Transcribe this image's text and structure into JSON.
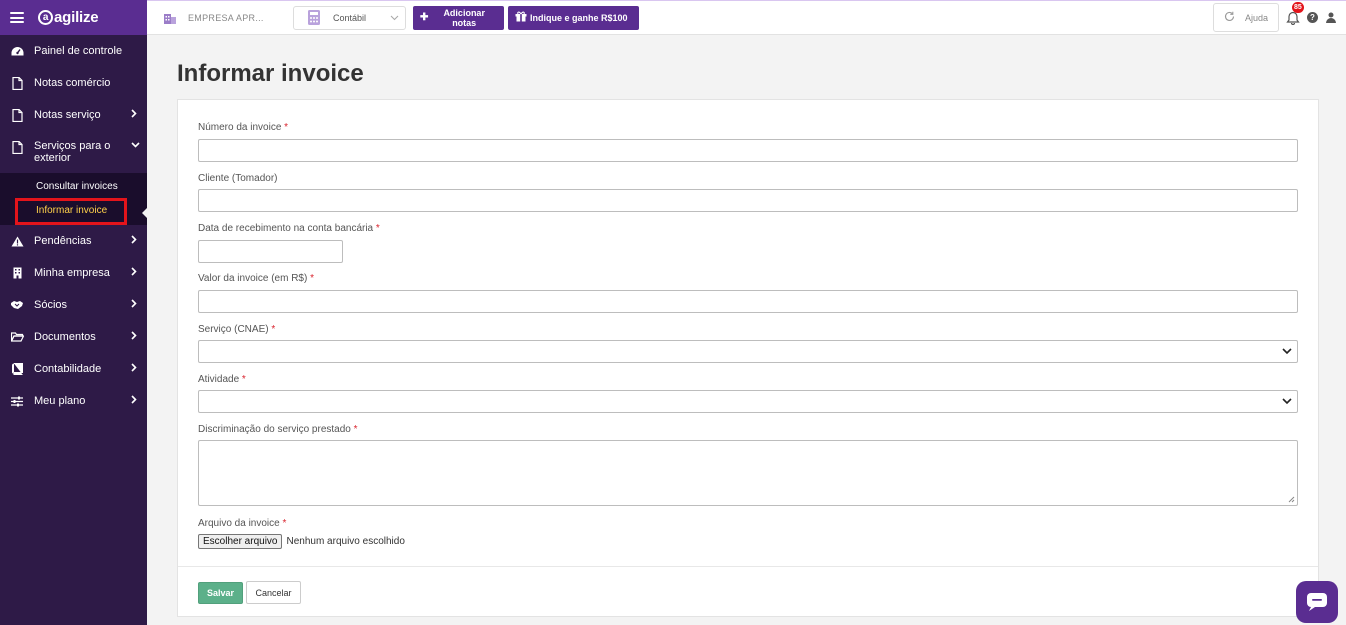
{
  "sidebar": {
    "brand": "agilize",
    "brand_mark": "a",
    "items": [
      {
        "label": "Painel de controle",
        "icon": "dashboard-icon",
        "chevron": false
      },
      {
        "label": "Notas comércio",
        "icon": "document-icon",
        "chevron": false
      },
      {
        "label": "Notas serviço",
        "icon": "document-icon",
        "chevron": true
      },
      {
        "label": "Serviços para o exterior",
        "icon": "document-icon",
        "chevron": "down"
      },
      {
        "label": "Pendências",
        "icon": "warning-icon",
        "chevron": true
      },
      {
        "label": "Minha empresa",
        "icon": "building-icon",
        "chevron": true
      },
      {
        "label": "Sócios",
        "icon": "handshake-icon",
        "chevron": true
      },
      {
        "label": "Documentos",
        "icon": "folder-icon",
        "chevron": true
      },
      {
        "label": "Contabilidade",
        "icon": "book-icon",
        "chevron": true
      },
      {
        "label": "Meu plano",
        "icon": "sliders-icon",
        "chevron": true
      }
    ],
    "subitems": [
      {
        "label": "Consultar invoices",
        "active": false
      },
      {
        "label": "Informar invoice",
        "active": true
      }
    ]
  },
  "topbar": {
    "company": "EMPRESA APR...",
    "profile_selector": "Contábil",
    "add_notes": "Adicionar notas",
    "referral": "Indique e ganhe R$100",
    "help": "Ajuda",
    "notification_count": "85"
  },
  "page": {
    "title": "Informar invoice"
  },
  "form": {
    "invoice_number_label": "Número da invoice",
    "client_label": "Cliente (Tomador)",
    "date_label": "Data de recebimento na conta bancária",
    "value_label": "Valor da invoice (em R$)",
    "service_label": "Serviço (CNAE)",
    "activity_label": "Atividade",
    "description_label": "Discriminação do serviço prestado",
    "file_label": "Arquivo da invoice",
    "file_button": "Escolher arquivo",
    "file_status": "Nenhum arquivo escolhido",
    "required_mark": "*",
    "save": "Salvar",
    "cancel": "Cancelar"
  },
  "colors": {
    "brand_purple": "#5a2d91",
    "sidebar_bg": "#2e1a47",
    "active_sub": "#ffd14a",
    "highlight_red": "#e3141b",
    "save_green": "#5cb08a"
  }
}
